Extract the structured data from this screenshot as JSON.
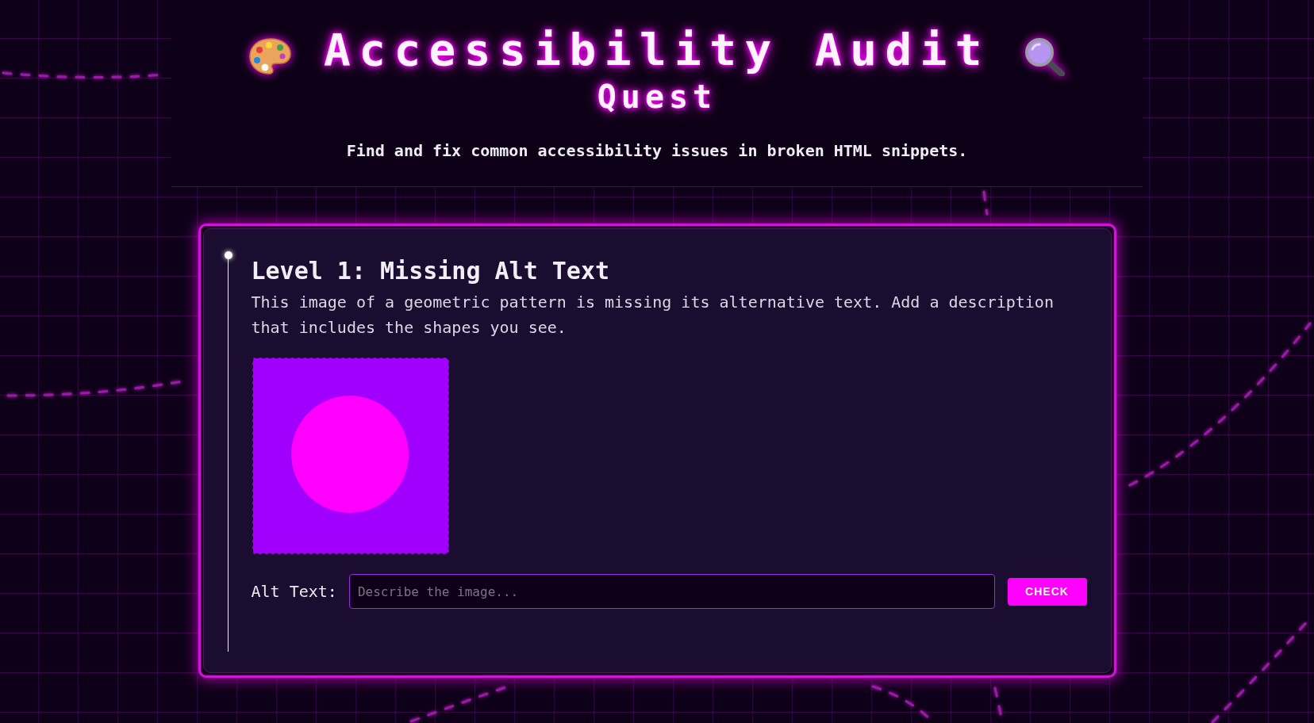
{
  "header": {
    "title_lines": [
      "Accessibility Audit",
      "Quest"
    ],
    "subtitle": "Find and fix common accessibility issues in broken HTML snippets."
  },
  "level": {
    "title": "Level 1: Missing Alt Text",
    "description": "This image of a geometric pattern is missing its alternative text. Add a description that includes the shapes you see.",
    "alt_text_field": {
      "label": "Alt Text:",
      "placeholder": "Describe the image..."
    },
    "check_button": {
      "label": "CHECK"
    }
  }
}
